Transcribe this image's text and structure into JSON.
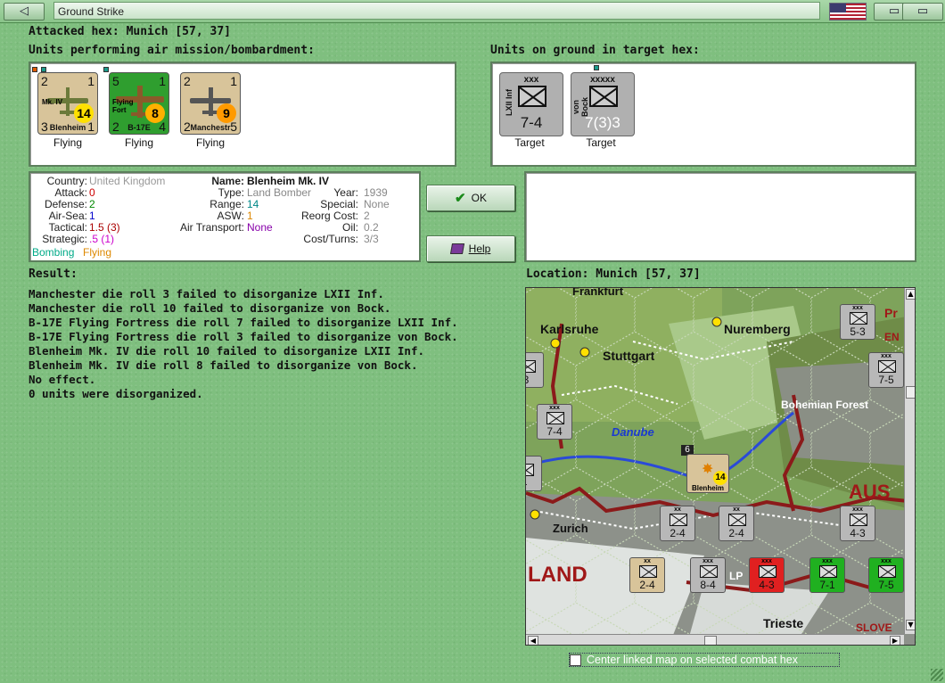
{
  "window": {
    "title": "Ground Strike",
    "left_button": "◁",
    "right_buttons": [
      "▭",
      "▭"
    ]
  },
  "attacked_hex": "Attacked hex: Munich  [57, 37]",
  "air_section_label": "Units performing air mission/bombardment:",
  "ground_section_label": "Units on ground in target hex:",
  "air_units": [
    {
      "name": "Blenheim",
      "sub": "Mk. IV",
      "tl": "2",
      "tr": "1",
      "bl": "3",
      "br": "1",
      "badge": "14",
      "status": "Flying",
      "bg": "#d8c49a",
      "badge_bg": "#ffe000"
    },
    {
      "name": "B-17E",
      "sub": "Flying Fort",
      "tl": "5",
      "tr": "1",
      "bl": "2",
      "br": "4",
      "badge": "8",
      "status": "Flying",
      "bg": "#2f9e2f",
      "badge_bg": "#ffb000"
    },
    {
      "name": "Manchestr",
      "sub": "",
      "tl": "2",
      "tr": "1",
      "bl": "2",
      "br": "5",
      "badge": "9",
      "status": "Flying",
      "bg": "#d8c49a",
      "badge_bg": "#ff9a00"
    }
  ],
  "ground_units": [
    {
      "name": "LXII Inf",
      "size": "xxx",
      "strength": "7-4",
      "status": "Target"
    },
    {
      "name": "von Bock",
      "size": "xxxxx",
      "strength": "7(3)3",
      "status": "Target"
    }
  ],
  "info": {
    "col1": [
      {
        "k": "Country:",
        "v": "United Kingdom",
        "c": "#999999"
      },
      {
        "k": "Attack:",
        "v": "0",
        "c": "#cc0000"
      },
      {
        "k": "Defense:",
        "v": "2",
        "c": "#008800"
      },
      {
        "k": "Air-Sea:",
        "v": "1",
        "c": "#0000cc"
      },
      {
        "k": "Tactical:",
        "v": "1.5 (3)",
        "c": "#aa0000"
      },
      {
        "k": "Strategic:",
        "v": ".5 (1)",
        "c": "#cc00cc"
      }
    ],
    "mission_a": "Bombing",
    "mission_b": "Flying",
    "name_key": "Name:",
    "name_val": "Blenheim Mk. IV",
    "col2": [
      {
        "k": "Type:",
        "v": "Land Bomber",
        "c": "#888888"
      },
      {
        "k": "Range:",
        "v": "14",
        "c": "#008888"
      },
      {
        "k": "ASW:",
        "v": "1",
        "c": "#dd8800"
      },
      {
        "k": "Air Transport:",
        "v": "None",
        "c": "#8800aa"
      }
    ],
    "col3": [
      {
        "k": "Year:",
        "v": "1939",
        "c": "#888888"
      },
      {
        "k": "Special:",
        "v": "None",
        "c": "#888888"
      },
      {
        "k": "Reorg Cost:",
        "v": "2",
        "c": "#888888"
      },
      {
        "k": "Oil:",
        "v": "0.2",
        "c": "#888888"
      },
      {
        "k": "Cost/Turns:",
        "v": "3/3",
        "c": "#888888"
      }
    ]
  },
  "buttons": {
    "ok": "OK",
    "help": "Help"
  },
  "result_label": "Result:",
  "results": [
    "Manchester die roll 3 failed to disorganize LXII Inf.",
    "Manchester die roll 10 failed to disorganize von Bock.",
    "B-17E Flying Fortress die roll 7 failed to disorganize LXII Inf.",
    "B-17E Flying Fortress die roll 3 failed to disorganize von Bock.",
    "Blenheim Mk. IV die roll 10 failed to disorganize LXII Inf.",
    "Blenheim Mk. IV die roll 8 failed to disorganize von Bock.",
    "No effect.",
    "0 units were disorganized."
  ],
  "location_label": "Location:  Munich  [57, 37]",
  "map": {
    "places": [
      "Frankfurt",
      "Karlsruhe",
      "Stuttgart",
      "Nuremberg",
      "Danube",
      "Bohemian Forest",
      "Zurich",
      "Trieste",
      "LAND",
      "AUS",
      "SLOVE",
      "LP",
      "Pr",
      "EN"
    ],
    "units": [
      {
        "s": "5-3",
        "bg": "#b8b8b8"
      },
      {
        "s": "7-5",
        "bg": "#b8b8b8"
      },
      {
        "s": "3",
        "bg": "#b8b8b8"
      },
      {
        "s": "7-4",
        "bg": "#b8b8b8"
      },
      {
        "s": "4",
        "bg": "#b8b8b8"
      },
      {
        "s": "2-4",
        "bg": "#b8b8b8"
      },
      {
        "s": "2-4",
        "bg": "#b8b8b8"
      },
      {
        "s": "4-3",
        "bg": "#b8b8b8"
      },
      {
        "s": "2-4",
        "bg": "#d8c49a"
      },
      {
        "s": "8-4",
        "bg": "#b8b8b8"
      },
      {
        "s": "4-3",
        "bg": "#e02020"
      },
      {
        "s": "7-1",
        "bg": "#20b020"
      },
      {
        "s": "7-5",
        "bg": "#20b020"
      }
    ],
    "stack_count": "6",
    "map_unit_name": "Blenheim",
    "map_unit_badge": "14"
  },
  "checkbox_label": "Center linked map on selected combat hex"
}
